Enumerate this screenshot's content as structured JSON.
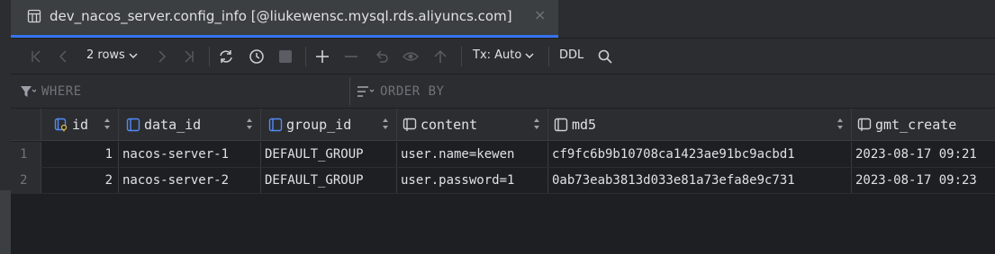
{
  "tab": {
    "title": "dev_nacos_server.config_info [@liukewensc.mysql.rds.aliyuncs.com]",
    "close": "×"
  },
  "toolbar": {
    "rows_label": "2 rows",
    "tx_label": "Tx: Auto",
    "ddl_label": "DDL"
  },
  "filters": {
    "where": "WHERE",
    "order_by": "ORDER BY"
  },
  "table": {
    "columns": [
      "id",
      "data_id",
      "group_id",
      "content",
      "md5",
      "gmt_create"
    ],
    "rows": [
      {
        "num": "1",
        "id": "1",
        "data_id": "nacos-server-1",
        "group_id": "DEFAULT_GROUP",
        "content": "user.name=kewen",
        "md5": "cf9fc6b9b10708ca1423ae91bc9acbd1",
        "gmt_create": "2023-08-17 09:21"
      },
      {
        "num": "2",
        "id": "2",
        "data_id": "nacos-server-2",
        "group_id": "DEFAULT_GROUP",
        "content": "user.password=1",
        "md5": "0ab73eab3813d033e81a73efa8e9c731",
        "gmt_create": "2023-08-17 09:23"
      }
    ]
  },
  "colors": {
    "accent": "#3574f0",
    "background": "#1e1f22",
    "panel": "#2b2d30",
    "text": "#dfe1e5",
    "muted": "#6f737a"
  },
  "icons": [
    "table-icon",
    "first-page-icon",
    "prev-page-icon",
    "next-page-icon",
    "last-page-icon",
    "refresh-icon",
    "history-icon",
    "stop-icon",
    "add-row-icon",
    "remove-row-icon",
    "revert-icon",
    "preview-icon",
    "submit-icon",
    "search-icon",
    "filter-icon",
    "sort-icon",
    "primary-key-column-icon",
    "column-icon"
  ]
}
